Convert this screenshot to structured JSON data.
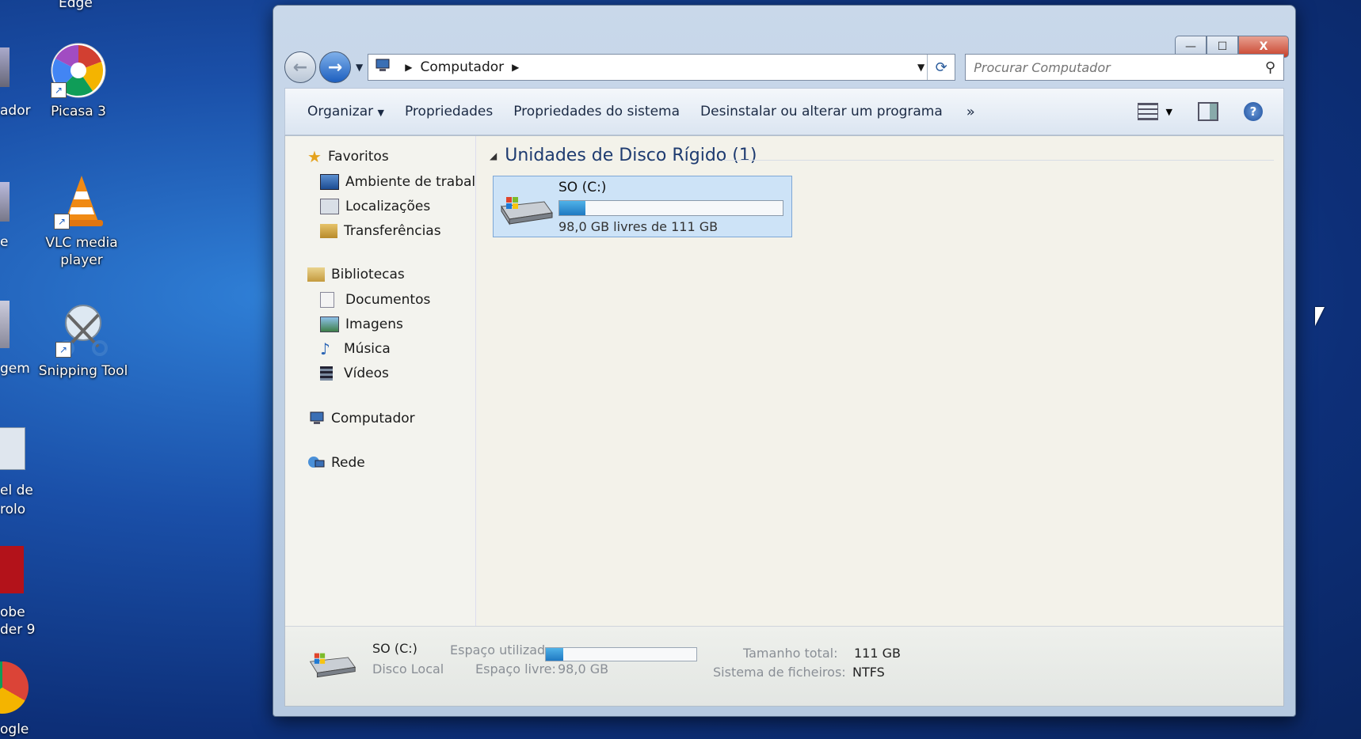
{
  "desktop": {
    "top_partial": "Edge",
    "left_partial": [
      "ador",
      "e",
      "gem",
      "el de",
      "rolo",
      "obe",
      "der 9",
      "ogle"
    ],
    "icons": [
      {
        "label": "Picasa 3",
        "icon": "picasa-icon"
      },
      {
        "label": "VLC media player",
        "icon": "vlc-icon"
      },
      {
        "label": "Snipping Tool",
        "icon": "snipping-tool-icon"
      }
    ]
  },
  "window": {
    "caption": {
      "minimize": "—",
      "maximize": "☐",
      "close": "X"
    },
    "address": {
      "location": "Computador"
    },
    "search": {
      "placeholder": "Procurar Computador"
    },
    "toolbar": {
      "organize": "Organizar",
      "properties": "Propriedades",
      "system_properties": "Propriedades do sistema",
      "uninstall": "Desinstalar ou alterar um programa",
      "more": "»"
    },
    "nav": {
      "favorites": {
        "label": "Favoritos",
        "items": [
          "Ambiente de trabalh",
          "Localizações",
          "Transferências"
        ]
      },
      "libraries": {
        "label": "Bibliotecas",
        "items": [
          "Documentos",
          "Imagens",
          "Música",
          "Vídeos"
        ]
      },
      "computer": "Computador",
      "network": "Rede"
    },
    "section": {
      "title": "Unidades de Disco Rígido (1)"
    },
    "drive": {
      "name": "SO (C:)",
      "free_text": "98,0 GB livres de 111 GB",
      "used_fraction": 0.117
    },
    "details": {
      "name": "SO (C:)",
      "type": "Disco Local",
      "used_label": "Espaço utilizado:",
      "free_label": "Espaço livre:",
      "free_value": "98,0 GB",
      "total_label": "Tamanho total:",
      "total_value": "111 GB",
      "fs_label": "Sistema de ficheiros:",
      "fs_value": "NTFS"
    }
  },
  "colors": {
    "accent": "#1f79c2",
    "selection": "#cde3f7"
  }
}
